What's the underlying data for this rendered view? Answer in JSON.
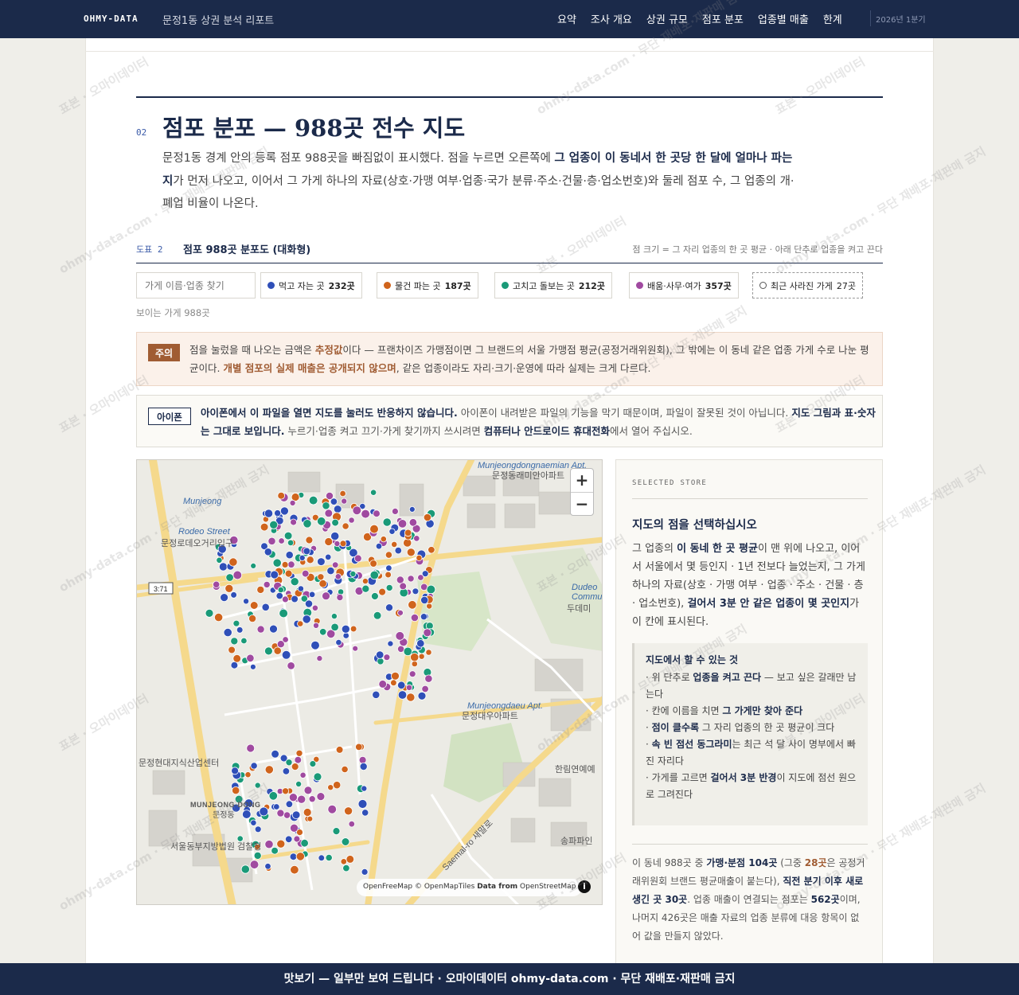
{
  "nav": {
    "brand": "OHMY-DATA",
    "doc_title": "문정1동 상권 분석 리포트",
    "links": [
      "요약",
      "조사 개요",
      "상권 규모",
      "점포 분포",
      "업종별 매출",
      "한계"
    ],
    "period": "2026년 1분기"
  },
  "section": {
    "number": "02",
    "title": "점포 분포 — 988곳 전수 지도",
    "intro_a": "문정1동 경계 안의 등록 점포 988곳을 빠짐없이 표시했다. 점을 누르면 오른쪽에 ",
    "intro_b": "그 업종이 이 동네서 한 곳당 한 달에 얼마나 파는지",
    "intro_c": "가 먼저 나오고, 이어서 그 가게 하나의 자료(상호·가맹 여부·업종·국가 분류·주소·건물·층·업소번호)와 둘레 점포 수, 그 업종의 개·폐업 비율이 나온다."
  },
  "figure": {
    "label": "도표 2",
    "title": "점포 988곳 분포도 (대화형)",
    "hint": "점 크기 = 그 자리 업종의 한 곳 평균 · 아래 단추로 업종을 켜고 끈다"
  },
  "filters": {
    "search_placeholder": "가게 이름·업종 찾기",
    "chips": [
      {
        "label": "먹고 자는 곳",
        "count": "232곳",
        "color": "#2f4fb8"
      },
      {
        "label": "물건 파는 곳",
        "count": "187곳",
        "color": "#d0641c"
      },
      {
        "label": "고치고 돌보는 곳",
        "count": "212곳",
        "color": "#1a9a78"
      },
      {
        "label": "배움·사무·여가",
        "count": "357곳",
        "color": "#a04aa0"
      },
      {
        "label": "최근 사라진 가게",
        "count": "27곳",
        "color": "#ffffff"
      }
    ],
    "visible_count": "보이는 가게 988곳"
  },
  "caution": {
    "tag": "주의",
    "a": "점을 눌렀을 때 나오는 금액은 ",
    "b": "추정값",
    "c": "이다 — 프랜차이즈 가맹점이면 그 브랜드의 서울 가맹점 평균(공정거래위원회), 그 밖에는 이 동네 같은 업종 가게 수로 나눈 평균이다. ",
    "d": "개별 점포의 실제 매출은 공개되지 않으며",
    "e": ", 같은 업종이라도 자리·크기·운영에 따라 실제는 크게 다르다."
  },
  "iphone": {
    "tag": "아이폰",
    "a": "아이폰에서 이 파일을 열면 지도를 눌러도 반응하지 않습니다.",
    "b": " 아이폰이 내려받은 파일의 기능을 막기 때문이며, 파일이 잘못된 것이 아닙니다. ",
    "c": "지도 그림과 표·숫자는 그대로 보입니다.",
    "d": " 누르기·업종 켜고 끄기·가게 찾기까지 쓰시려면 ",
    "e": "컴퓨터나 안드로이드 휴대전화",
    "f": "에서 열어 주십시오."
  },
  "map": {
    "zoom_in": "+",
    "zoom_out": "−",
    "attribution_a": "OpenFreeMap © OpenMapTiles ",
    "attribution_b": "Data from",
    "attribution_c": " OpenStreetMap",
    "info": "i",
    "labels": {
      "l1": "Munjeongdongnaemian Apt.",
      "l2": "문정동래미안아파트",
      "l3": "Munjeong",
      "l4": "Rodeo Street",
      "l5": "문정로데오거리입구",
      "l6": "3:71",
      "l7": "Dudeo",
      "l8": "Commu",
      "l9": "두데미",
      "l10": "Munjeongdaeu Apt.",
      "l11": "문정대우아파트",
      "l12": "문정현대지식산업센터",
      "l13": "한림연예예",
      "l14": "MUNJEONG-DONG",
      "l15": "문정동",
      "l16": "서울동부지방법원 검찰청",
      "l17": "송파파인",
      "l18": "Saemal-ro 새말로"
    }
  },
  "side": {
    "caption": "SELECTED STORE",
    "heading": "지도의 점을 선택하십시오",
    "p1_a": "그 업종의 ",
    "p1_b": "이 동네 한 곳 평균",
    "p1_c": "이 맨 위에 나오고, 이어서 서울에서 몇 등인지 · 1년 전보다 늘었는지, 그 가게 하나의 자료(상호 · 가맹 여부 · 업종 · 주소 · 건물 · 층 · 업소번호), ",
    "p1_d": "걸어서 3분 안 같은 업종이 몇 곳인지",
    "p1_e": "가 이 칸에 표시된다.",
    "box_title": "지도에서 할 수 있는 것",
    "box_items": [
      {
        "a": "· 위 단추로 ",
        "b": "업종을 켜고 끈다",
        "c": " — 보고 싶은 갈래만 남는다"
      },
      {
        "a": "· 칸에 이름을 치면 ",
        "b": "그 가게만 찾아 준다",
        "c": ""
      },
      {
        "a": "· ",
        "b": "점이 클수록",
        "c": " 그 자리 업종의 한 곳 평균이 크다"
      },
      {
        "a": "· ",
        "b": "속 빈 점선 동그라미",
        "c": "는 최근 석 달 사이 명부에서 빠진 자리다"
      },
      {
        "a": "· 가게를 고르면 ",
        "b": "걸어서 3분 반경",
        "c": "이 지도에 점선 원으로 그려진다"
      }
    ],
    "p2_a": "이 동네 988곳 중 ",
    "p2_b": "가맹·분점 104곳",
    "p2_c": " (그중 ",
    "p2_d": "28곳",
    "p2_e": "은 공정거래위원회 브랜드 평균매출이 붙는다), ",
    "p2_f": "직전 분기 이후 새로 생긴 곳 30곳",
    "p2_g": ". 업종 매출이 연결되는 점포는 ",
    "p2_h": "562곳",
    "p2_i": "이며, 나머지 426곳은 매출 자료의 업종 분류에 대응 항목이 없어 값을 만들지 않았다."
  },
  "footer": {
    "text": "맛보기 — 일부만 보여 드립니다 · 오마이데이터 ohmy-data.com · 무단 재배포·재판매 금지"
  },
  "watermark": {
    "a": "표본 · 오마이데이터",
    "b": "ohmy-data.com · 무단 재배포·재판매 금지"
  }
}
